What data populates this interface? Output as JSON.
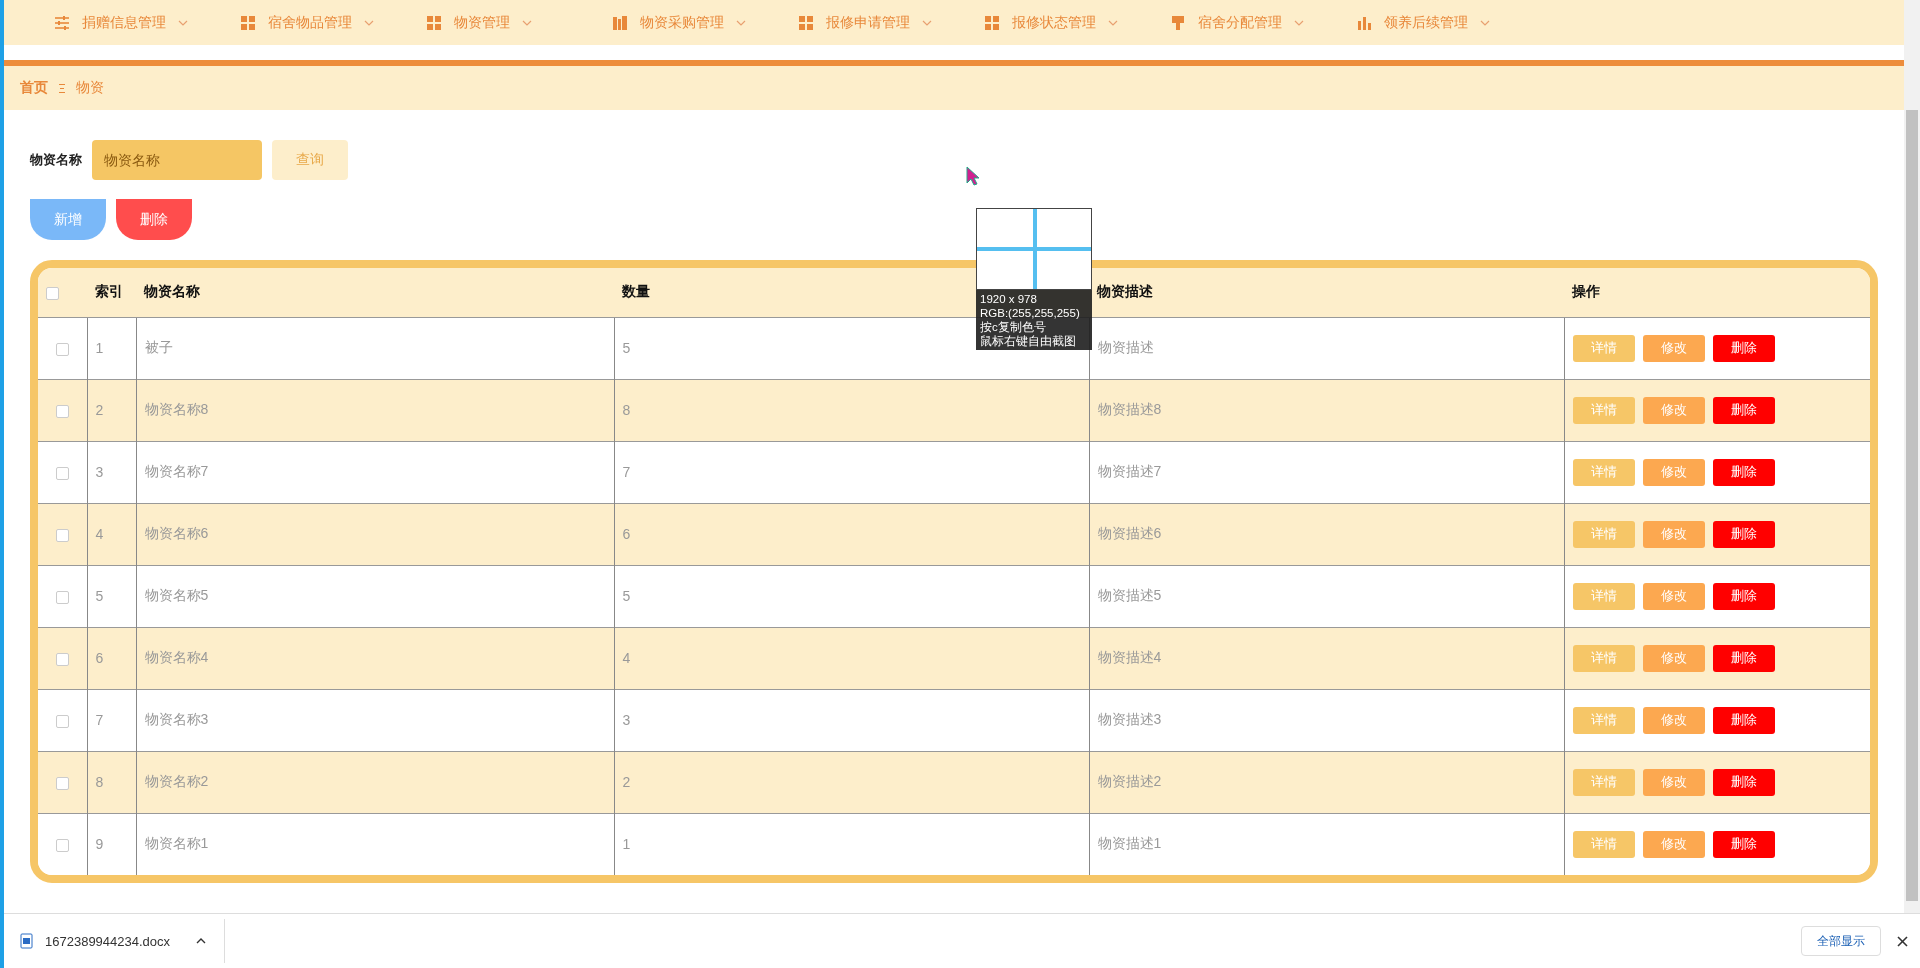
{
  "nav": {
    "items": [
      {
        "label": "捐赠信息管理"
      },
      {
        "label": "宿舍物品管理"
      },
      {
        "label": "物资管理"
      },
      {
        "label": "物资采购管理"
      },
      {
        "label": "报修申请管理"
      },
      {
        "label": "报修状态管理"
      },
      {
        "label": "宿舍分配管理"
      },
      {
        "label": "领养后续管理"
      }
    ]
  },
  "breadcrumb": [
    "首页",
    "物资"
  ],
  "search": {
    "label": "物资名称",
    "placeholder": "物资名称",
    "button": "查询"
  },
  "actions": [
    {
      "label": "新增",
      "kind": "add"
    },
    {
      "label": "删除",
      "kind": "delete"
    }
  ],
  "table": {
    "header_checked": false,
    "columns": [
      "索引",
      "物资名称",
      "数量",
      "物资描述",
      "操作"
    ],
    "rows": [
      {
        "checked": false,
        "cells": [
          "1",
          "被子",
          "5",
          "物资描述"
        ],
        "buttons": [
          "详情",
          "修改",
          "删除"
        ]
      },
      {
        "checked": false,
        "cells": [
          "2",
          "物资名称8",
          "8",
          "物资描述8"
        ],
        "buttons": [
          "详情",
          "修改",
          "删除"
        ]
      },
      {
        "checked": false,
        "cells": [
          "3",
          "物资名称7",
          "7",
          "物资描述7"
        ],
        "buttons": [
          "详情",
          "修改",
          "删除"
        ]
      },
      {
        "checked": false,
        "cells": [
          "4",
          "物资名称6",
          "6",
          "物资描述6"
        ],
        "buttons": [
          "详情",
          "修改",
          "删除"
        ]
      },
      {
        "checked": false,
        "cells": [
          "5",
          "物资名称5",
          "5",
          "物资描述5"
        ],
        "buttons": [
          "详情",
          "修改",
          "删除"
        ]
      },
      {
        "checked": false,
        "cells": [
          "6",
          "物资名称4",
          "4",
          "物资描述4"
        ],
        "buttons": [
          "详情",
          "修改",
          "删除"
        ]
      },
      {
        "checked": false,
        "cells": [
          "7",
          "物资名称3",
          "3",
          "物资描述3"
        ],
        "buttons": [
          "详情",
          "修改",
          "删除"
        ]
      },
      {
        "checked": false,
        "cells": [
          "8",
          "物资名称2",
          "2",
          "物资描述2"
        ],
        "buttons": [
          "详情",
          "修改",
          "删除"
        ]
      },
      {
        "checked": false,
        "cells": [
          "9",
          "物资名称1",
          "1",
          "物资描述1"
        ],
        "buttons": [
          "详情",
          "修改",
          "删除"
        ]
      }
    ]
  },
  "color_picker": {
    "lines": [
      "1920 x 978",
      "RGB:(255,255,255)",
      "按c复制色号",
      "鼠标右键自由截图"
    ]
  },
  "download_bar": {
    "file": "1672389944234.docx",
    "show_all": "全部显示"
  }
}
